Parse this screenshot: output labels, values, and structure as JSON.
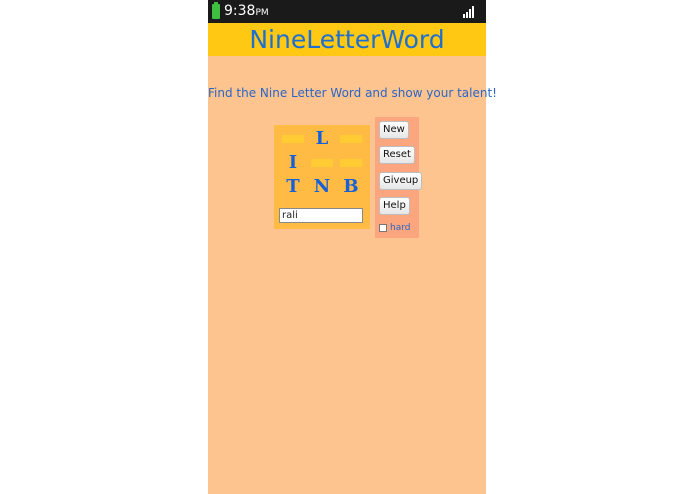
{
  "status_bar": {
    "time": "9:38",
    "time_suffix": "PM",
    "battery_icon": "battery-icon",
    "signal_icon": "signal-icon"
  },
  "app": {
    "title": "NineLetterWord",
    "tagline": "Find the Nine Letter Word and show your talent!"
  },
  "board": {
    "cells": [
      "",
      "L",
      "",
      "I",
      "",
      "",
      "T",
      "N",
      "B"
    ]
  },
  "input": {
    "value": "rali"
  },
  "controls": {
    "new_label": "New",
    "reset_label": "Reset",
    "giveup_label": "Giveup",
    "help_label": "Help",
    "hard_label": "hard",
    "hard_checked": false
  },
  "colors": {
    "background": "#fdc48f",
    "title_bar": "#ffc812",
    "title_text": "#1f6fcf",
    "letter": "#1660d9",
    "board": "#ffbb44",
    "controls_panel": "#fba67e"
  }
}
